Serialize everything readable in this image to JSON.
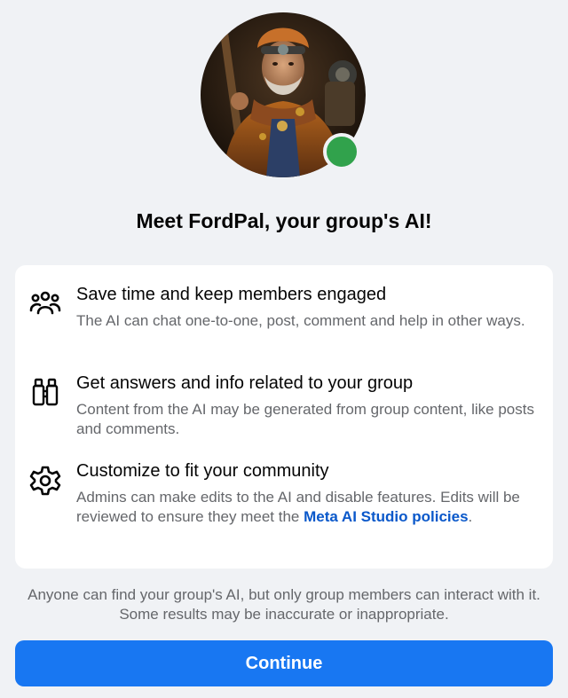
{
  "header": {
    "title": "Meet FordPal, your group's AI!"
  },
  "features": [
    {
      "icon": "people-icon",
      "title": "Save time and keep members engaged",
      "description": "The AI can chat one-to-one, post, comment and help in other ways."
    },
    {
      "icon": "binoculars-icon",
      "title": "Get answers and info related to your group",
      "description": "Content from the AI may be generated from group content, like posts and comments."
    },
    {
      "icon": "gear-icon",
      "title": "Customize to fit your community",
      "description_before": "Admins can make edits to the AI and disable features. Edits will be reviewed to ensure they meet the ",
      "link_text": "Meta AI Studio policies",
      "description_after": "."
    }
  ],
  "disclaimer": "Anyone can find your group's AI, but only group members can interact with it. Some results may be inaccurate or inappropriate.",
  "continue_label": "Continue",
  "colors": {
    "background": "#f0f2f5",
    "accent": "#1877f2",
    "link": "#0a58ca",
    "online": "#31a24c"
  }
}
